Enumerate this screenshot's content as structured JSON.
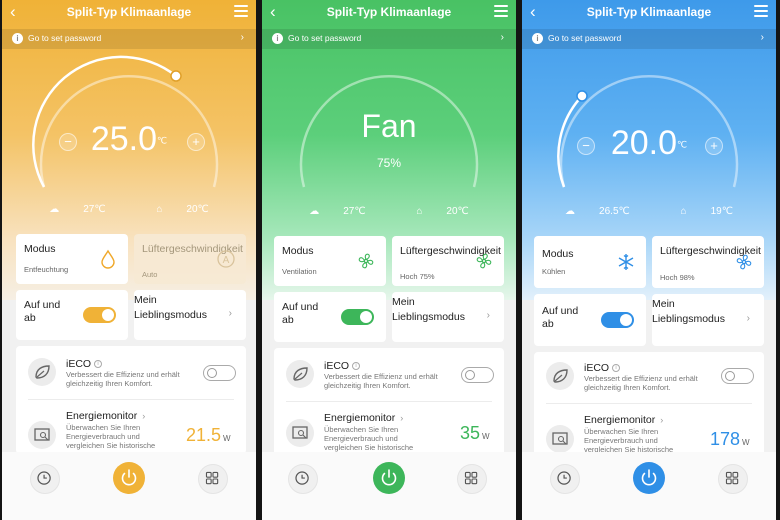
{
  "screens": [
    {
      "theme": "orange",
      "accent": "#f0b237",
      "title": "Split-Typ Klimaanlage",
      "password_bar": "Go to set password",
      "dial_type": "temperature",
      "temperature": "25.0",
      "unit": "℃",
      "outdoor_temp": "27℃",
      "indoor_temp": "20℃",
      "mode_label": "Modus",
      "mode_value": "Entfeuchtung",
      "mode_icon": "droplet-icon",
      "fan_label": "Lüftergeschwindigkeit",
      "fan_value": "Auto",
      "fan_icon": "auto-icon",
      "swing_label": "Auf und ab",
      "swing_on": true,
      "favorite_label": "Mein Lieblingsmodus",
      "eco_title": "iECO",
      "eco_desc": "Verbessert die Effizienz und erhält gleichzeitig Ihren Komfort.",
      "energy_title": "Energiemonitor",
      "energy_desc": "Überwachen Sie Ihren Energieverbrauch und vergleichen Sie historische",
      "energy_value": "21.5",
      "energy_unit": "W"
    },
    {
      "theme": "green",
      "accent": "#49c264",
      "title": "Split-Typ Klimaanlage",
      "password_bar": "Go to set password",
      "dial_type": "fan",
      "fan_text": "Fan",
      "fan_percent": "75%",
      "outdoor_temp": "27℃",
      "indoor_temp": "20℃",
      "mode_label": "Modus",
      "mode_value": "Ventilation",
      "mode_icon": "fan-icon",
      "fan_label": "Lüftergeschwindigkeit",
      "fan_value": "Hoch 75%",
      "fan_icon": "fan-icon",
      "swing_label": "Auf und ab",
      "swing_on": true,
      "favorite_label": "Mein Lieblingsmodus",
      "eco_title": "iECO",
      "eco_desc": "Verbessert die Effizienz und erhält gleichzeitig Ihren Komfort.",
      "energy_title": "Energiemonitor",
      "energy_desc": "Überwachen Sie Ihren Energieverbrauch und vergleichen Sie historische Daten.",
      "energy_value": "35",
      "energy_unit": "W"
    },
    {
      "theme": "blue",
      "accent": "#2f8fe6",
      "title": "Split-Typ Klimaanlage",
      "password_bar": "Go to set password",
      "dial_type": "temperature",
      "temperature": "20.0",
      "unit": "℃",
      "outdoor_temp": "26.5℃",
      "indoor_temp": "19℃",
      "mode_label": "Modus",
      "mode_value": "Kühlen",
      "mode_icon": "snowflake-icon",
      "fan_label": "Lüftergeschwindigkeit",
      "fan_value": "Hoch 98%",
      "fan_icon": "fan-icon",
      "swing_label": "Auf und ab",
      "swing_on": true,
      "favorite_label": "Mein Lieblingsmodus",
      "eco_title": "iECO",
      "eco_desc": "Verbessert die Effizienz und erhält gleichzeitig Ihren Komfort.",
      "energy_title": "Energiemonitor",
      "energy_desc": "Überwachen Sie Ihren Energieverbrauch und vergleichen Sie historische",
      "energy_value": "178",
      "energy_unit": "W"
    }
  ]
}
